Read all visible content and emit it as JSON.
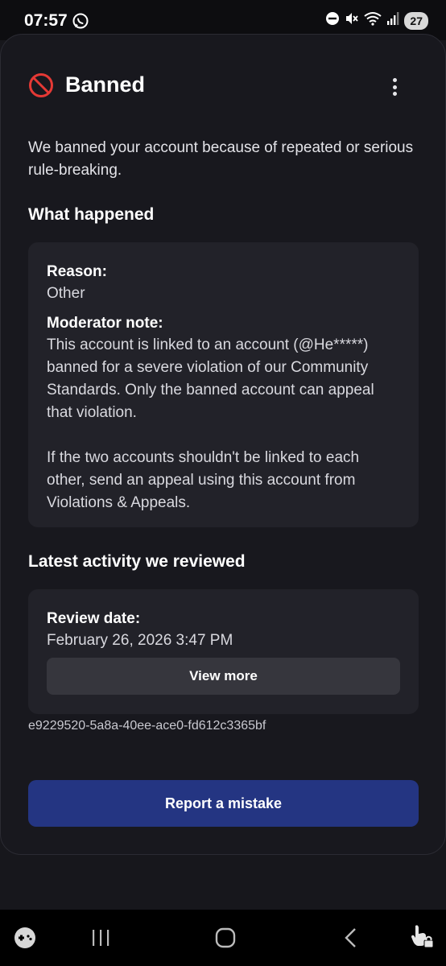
{
  "status_bar": {
    "time": "07:57",
    "battery": "27"
  },
  "header": {
    "title": "Banned"
  },
  "intro": "We banned your account because of repeated or serious rule-breaking.",
  "what_happened": {
    "heading": "What happened",
    "reason_label": "Reason:",
    "reason_value": "Other",
    "note_label": "Moderator note:",
    "note_para1": "This account is linked to an account (@He*****) banned for a severe violation of our Community Standards. Only the banned account can appeal that violation.",
    "note_para2": "If the two accounts shouldn't be linked to each other, send an appeal using this account from Violations & Appeals."
  },
  "latest_activity": {
    "heading": "Latest activity we reviewed",
    "review_date_label": "Review date:",
    "review_date_value": "February 26, 2026 3:47 PM",
    "view_more_label": "View more"
  },
  "reference_id": "e9229520-5a8a-40ee-ace0-fd612c3365bf",
  "report_button_label": "Report a mistake",
  "icons": {
    "ban": "ban-icon",
    "more": "more-vertical-icon",
    "whatsapp": "whatsapp-icon",
    "dnd": "do-not-disturb-icon",
    "mute": "mute-icon",
    "wifi": "wifi-icon",
    "signal": "signal-icon",
    "game": "game-launcher-icon",
    "recents": "recents-icon",
    "home": "home-icon",
    "back": "back-icon",
    "accessibility": "touch-lock-icon"
  },
  "colors": {
    "ban_red": "#e53935",
    "report_button": "#243582",
    "card": "#222229"
  }
}
